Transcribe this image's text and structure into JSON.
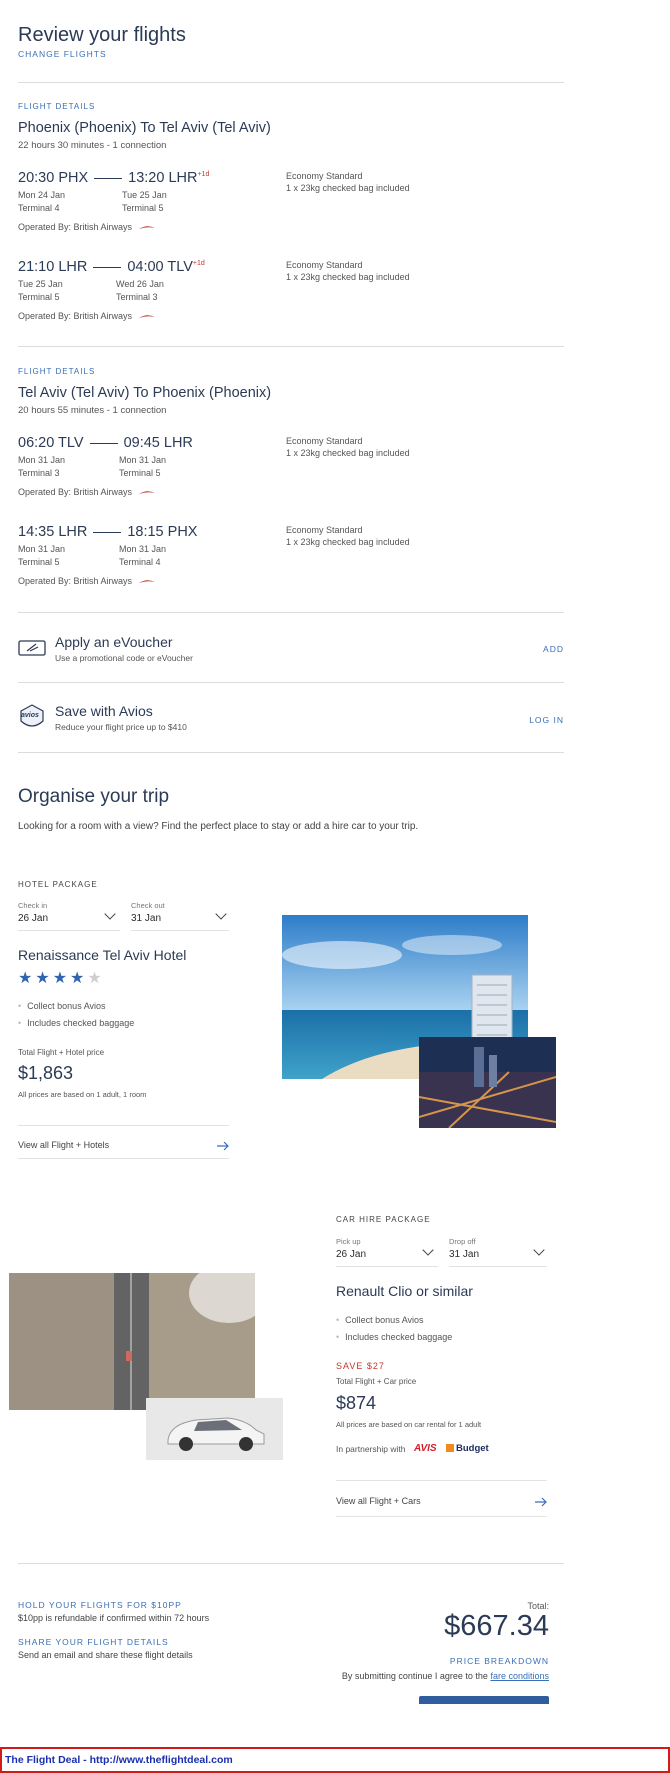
{
  "header": {
    "title": "Review your flights",
    "change_link": "CHANGE FLIGHTS"
  },
  "flights": [
    {
      "section_label": "FLIGHT DETAILS",
      "route": "Phoenix (Phoenix) To Tel Aviv (Tel Aviv)",
      "summary": "22 hours 30 minutes - 1 connection",
      "legs": [
        {
          "dep_time": "20:30 PHX",
          "dep_date": "Mon 24 Jan",
          "dep_terminal": "Terminal 4",
          "arr_time": "13:20 LHR",
          "arr_plus": "+1d",
          "arr_date": "Tue 25 Jan",
          "arr_terminal": "Terminal 5",
          "cabin": "Economy Standard",
          "bag": "1 x 23kg checked bag included",
          "operated": "Operated By: British Airways"
        },
        {
          "dep_time": "21:10 LHR",
          "dep_date": "Tue 25 Jan",
          "dep_terminal": "Terminal 5",
          "arr_time": "04:00 TLV",
          "arr_plus": "+1d",
          "arr_date": "Wed 26 Jan",
          "arr_terminal": "Terminal 3",
          "cabin": "Economy Standard",
          "bag": "1 x 23kg checked bag included",
          "operated": "Operated By: British Airways"
        }
      ]
    },
    {
      "section_label": "FLIGHT DETAILS",
      "route": "Tel Aviv (Tel Aviv) To Phoenix (Phoenix)",
      "summary": "20 hours 55 minutes - 1 connection",
      "legs": [
        {
          "dep_time": "06:20 TLV",
          "dep_date": "Mon 31 Jan",
          "dep_terminal": "Terminal 3",
          "arr_time": "09:45 LHR",
          "arr_plus": "",
          "arr_date": "Mon 31 Jan",
          "arr_terminal": "Terminal 5",
          "cabin": "Economy Standard",
          "bag": "1 x 23kg checked bag included",
          "operated": "Operated By: British Airways"
        },
        {
          "dep_time": "14:35 LHR",
          "dep_date": "Mon 31 Jan",
          "dep_terminal": "Terminal 5",
          "arr_time": "18:15 PHX",
          "arr_plus": "",
          "arr_date": "Mon 31 Jan",
          "arr_terminal": "Terminal 4",
          "cabin": "Economy Standard",
          "bag": "1 x 23kg checked bag included",
          "operated": "Operated By: British Airways"
        }
      ]
    }
  ],
  "voucher": {
    "title": "Apply an eVoucher",
    "sub": "Use a promotional code or eVoucher",
    "action": "ADD",
    "icon": "voucher-icon"
  },
  "avios": {
    "title": "Save with Avios",
    "sub": "Reduce your flight price up to $410",
    "action": "LOG IN",
    "icon": "avios-icon",
    "badge": "avios"
  },
  "organise": {
    "title": "Organise your trip",
    "intro": "Looking for a room with a view? Find the perfect place to stay or add a hire car to your trip."
  },
  "hotel": {
    "label": "HOTEL PACKAGE",
    "checkin_label": "Check in",
    "checkin_val": "26 Jan",
    "checkout_label": "Check out",
    "checkout_val": "31 Jan",
    "name": "Renaissance Tel Aviv Hotel",
    "stars": 4,
    "bullets": [
      "Collect bonus Avios",
      "Includes checked baggage"
    ],
    "price_label": "Total Flight + Hotel price",
    "price": "$1,863",
    "price_note": "All prices are based on 1 adult, 1 room",
    "view_all": "View all Flight + Hotels"
  },
  "car": {
    "label": "CAR HIRE PACKAGE",
    "pickup_label": "Pick up",
    "pickup_val": "26 Jan",
    "dropoff_label": "Drop off",
    "dropoff_val": "31 Jan",
    "name": "Renault Clio or similar",
    "bullets": [
      "Collect bonus Avios",
      "Includes checked baggage"
    ],
    "save": "SAVE $27",
    "price_label": "Total Flight + Car price",
    "price": "$874",
    "price_note": "All prices are based on car rental for 1 adult",
    "partner_text": "In partnership with",
    "partner_avis": "AVIS",
    "partner_budget": "Budget",
    "view_all": "View all Flight + Cars"
  },
  "footer": {
    "hold_title": "HOLD YOUR FLIGHTS FOR $10PP",
    "hold_sub": "$10pp is refundable if confirmed within 72 hours",
    "share_title": "SHARE YOUR FLIGHT DETAILS",
    "share_sub": "Send an email and share these flight details",
    "total_label": "Total:",
    "total": "$667.34",
    "breakdown": "PRICE BREAKDOWN",
    "terms_text": "By submitting continue I agree to the",
    "terms_link": "fare conditions"
  },
  "watermark": "The Flight Deal - http://www.theflightdeal.com",
  "colors": {
    "accent": "#3a6fb7",
    "navy": "#2b3a55",
    "red": "#c0392b",
    "star": "#2f64b1"
  }
}
